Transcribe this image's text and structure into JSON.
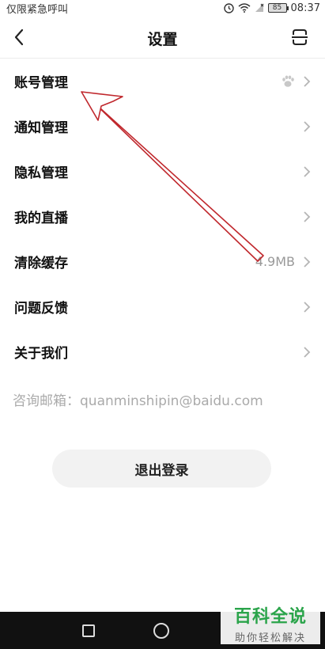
{
  "status_bar": {
    "left_text": "仅限紧急呼叫",
    "battery": "85",
    "time": "08:37"
  },
  "header": {
    "title": "设置",
    "back_icon": "back-arrow-icon",
    "scan_icon": "scan-icon"
  },
  "settings": [
    {
      "label": "账号管理",
      "value": "",
      "extra_icon": "paw-icon"
    },
    {
      "label": "通知管理",
      "value": ""
    },
    {
      "label": "隐私管理",
      "value": ""
    },
    {
      "label": "我的直播",
      "value": ""
    },
    {
      "label": "清除缓存",
      "value": "4.9MB"
    },
    {
      "label": "问题反馈",
      "value": ""
    },
    {
      "label": "关于我们",
      "value": ""
    }
  ],
  "contact": "咨询邮箱：quanminshipin@baidu.com",
  "logout_label": "退出登录",
  "watermark": {
    "main": "百科全说",
    "sub": "助你轻松解决"
  },
  "colors": {
    "annotation_arrow": "#c0282d",
    "watermark_green": "#2aa44a"
  }
}
